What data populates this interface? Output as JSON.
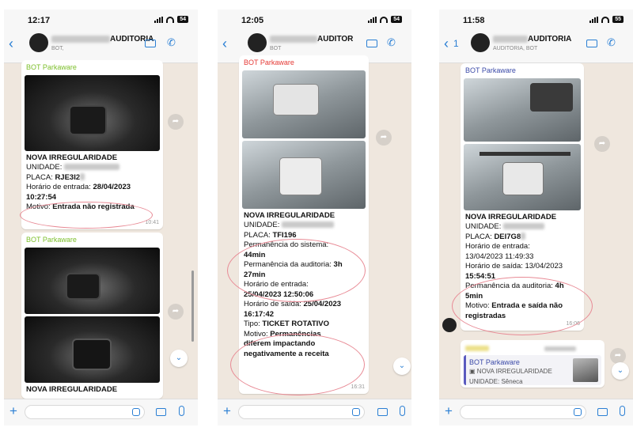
{
  "phones": [
    {
      "time": "12:17",
      "battery": "54",
      "contact_title": "AUDITORIA",
      "contact_subtitle": "BOT,",
      "messages": [
        {
          "sender": "BOT Parkaware",
          "heading": "NOVA IRREGULARIDADE",
          "unidade_label": "UNIDADE:",
          "placa_label": "PLACA:",
          "placa_value": "RJE3I2",
          "entrada_label": "Horário de entrada:",
          "entrada_value": "28/04/2023",
          "entrada_value2": "10:27:54",
          "motivo_label": "Motivo:",
          "motivo_value": "Entrada não registrada",
          "timestamp": "10:41"
        },
        {
          "sender": "BOT Parkaware",
          "heading": "NOVA IRREGULARIDADE"
        }
      ]
    },
    {
      "time": "12:05",
      "battery": "54",
      "contact_title": "AUDITOR",
      "contact_subtitle": "BOT",
      "message": {
        "sender": "BOT Parkaware",
        "heading": "NOVA IRREGULARIDADE",
        "unidade_label": "UNIDADE:",
        "placa_label": "PLACA:",
        "placa_value": "TFI196",
        "perm_sistema_label": "Permanência do sistema:",
        "perm_sistema_value": "44min",
        "perm_auditoria_label": "Permanência da auditoria:",
        "perm_auditoria_value_a": "3h",
        "perm_auditoria_value_b": "27min",
        "entrada_label": "Horário de entrada:",
        "entrada_value": "25/04/2023 12:50:06",
        "saida_label": "Horário de saída:",
        "saida_value_a": "25/04/2023",
        "saida_value_b": "16:17:42",
        "tipo_label": "Tipo:",
        "tipo_value": "TICKET ROTATIVO",
        "motivo_label": "Motivo:",
        "motivo_value_a": "Permanências",
        "motivo_value_b": "diferem impactando",
        "motivo_value_c": "negativamente a receita",
        "timestamp": "16:31"
      }
    },
    {
      "time": "11:58",
      "battery": "55",
      "back_count": "1",
      "contact_title": "AUDITORIA",
      "contact_subtitle": "AUDITORIA, BOT",
      "message": {
        "sender": "BOT Parkaware",
        "heading": "NOVA IRREGULARIDADE",
        "unidade_label": "UNIDADE:",
        "placa_label": "PLACA:",
        "placa_value": "DEI7G8",
        "entrada_label": "Horário de entrada:",
        "entrada_value": "13/04/2023 11:49:33",
        "saida_label": "Horário de saída:",
        "saida_value_a": "13/04/2023",
        "saida_value_b": "15:54:51",
        "perm_auditoria_label": "Permanência da auditoria:",
        "perm_auditoria_value_a": "4h",
        "perm_auditoria_value_b": "5min",
        "motivo_label": "Motivo:",
        "motivo_value_a": "Entrada e saída não",
        "motivo_value_b": "registradas",
        "timestamp": "16:06"
      },
      "reply": {
        "sender": "BOT Parkaware",
        "quoted_heading": "NOVA IRREGULARIDADE",
        "quoted_unidade_label": "UNIDADE:",
        "quoted_unidade_value": "Sêneca"
      }
    }
  ],
  "colors": {
    "chat_bg": "#efe7de",
    "accent": "#2a7fd4",
    "bot_name_green": "#7cbf2a",
    "bot_name_red": "#e53935",
    "bot_name_blue": "#3b4aa8",
    "annotation_oval": "#e88a95"
  },
  "icons": [
    "back-chevron-icon",
    "video-call-icon",
    "phone-call-icon",
    "forward-icon",
    "scroll-down-icon",
    "plus-icon",
    "sticker-icon",
    "camera-icon",
    "microphone-icon"
  ]
}
